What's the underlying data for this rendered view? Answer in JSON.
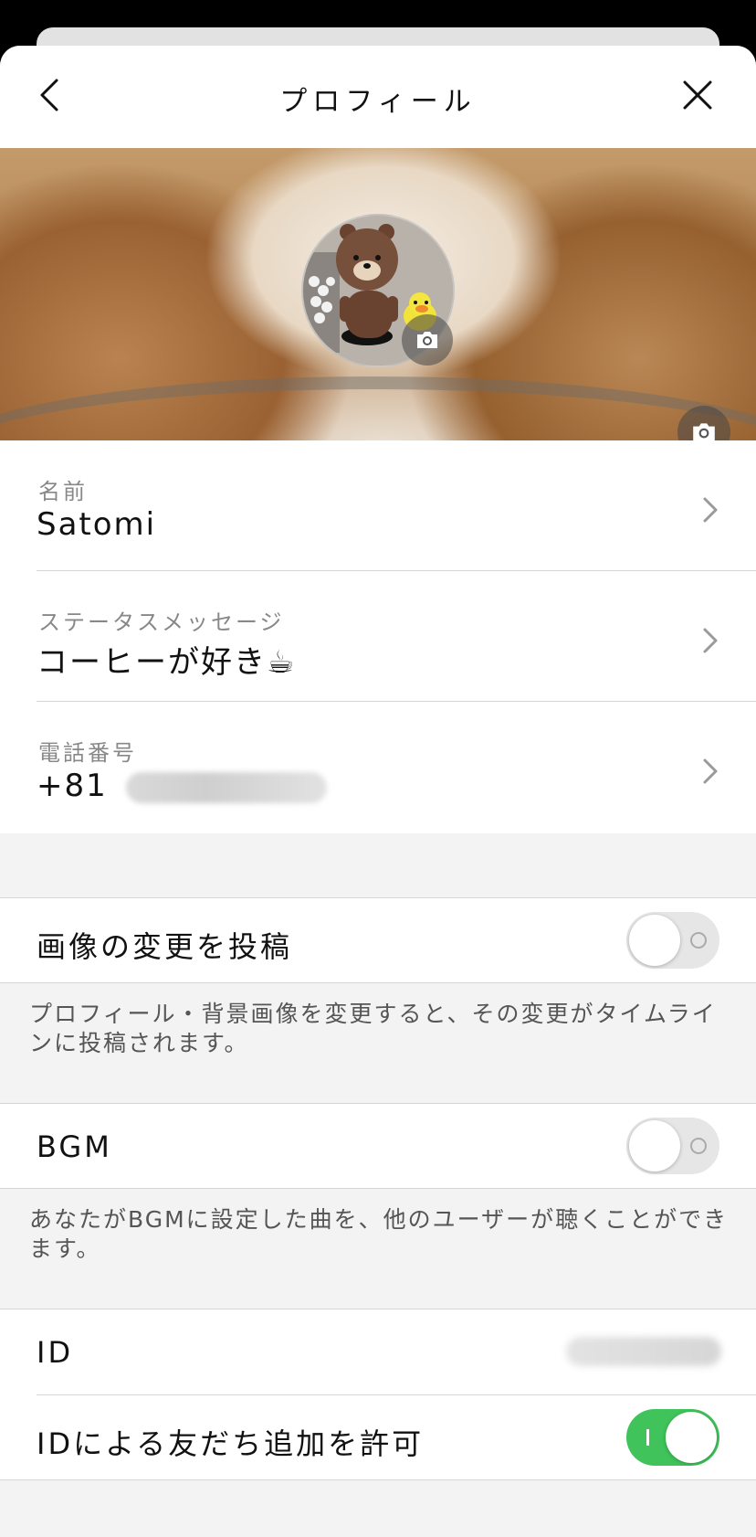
{
  "header": {
    "title": "プロフィール",
    "back_icon": "chevron-left-icon",
    "close_icon": "close-icon"
  },
  "cover": {
    "photo": "latte-art-coffee",
    "avatar": "bear-figurine-avatar",
    "camera_icon": "camera-icon"
  },
  "profile": {
    "name": {
      "label": "名前",
      "value": "Satomi"
    },
    "status": {
      "label": "ステータスメッセージ",
      "value": "コーヒーが好き☕"
    },
    "phone": {
      "label": "電話番号",
      "value": "+81"
    }
  },
  "settings": {
    "post_image_change": {
      "label": "画像の変更を投稿",
      "enabled": false,
      "note": "プロフィール・背景画像を変更すると、その変更がタイムラインに投稿されます。"
    },
    "bgm": {
      "label": "BGM",
      "enabled": false,
      "note": "あなたがBGMに設定した曲を、他のユーザーが聴くことができます。"
    },
    "id": {
      "label": "ID"
    },
    "allow_add_by_id": {
      "label": "IDによる友だち追加を許可",
      "enabled": true
    }
  },
  "colors": {
    "toggle_on": "#3fc35a",
    "toggle_off": "#e6e6e6",
    "background": "#f3f3f3"
  }
}
